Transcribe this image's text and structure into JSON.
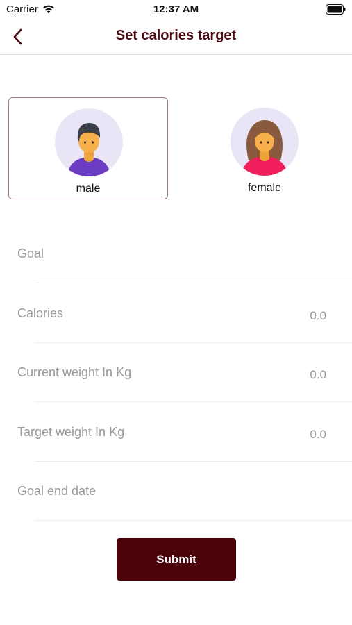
{
  "status_bar": {
    "carrier": "Carrier",
    "time": "12:37 AM"
  },
  "nav": {
    "title": "Set calories target"
  },
  "gender": {
    "male_label": "male",
    "female_label": "female",
    "selected": "male"
  },
  "form": {
    "rows": [
      {
        "label": "Goal",
        "value": ""
      },
      {
        "label": "Calories",
        "value": "0.0"
      },
      {
        "label": "Current weight In Kg",
        "value": "0.0"
      },
      {
        "label": "Target weight In Kg",
        "value": "0.0"
      },
      {
        "label": "Goal end date",
        "value": ""
      }
    ]
  },
  "submit": {
    "label": "Submit"
  },
  "colors": {
    "accent": "#4a0309",
    "title": "#4a0a12",
    "label": "#9a9a9a",
    "avatar_bg": "#e9e5f6"
  }
}
